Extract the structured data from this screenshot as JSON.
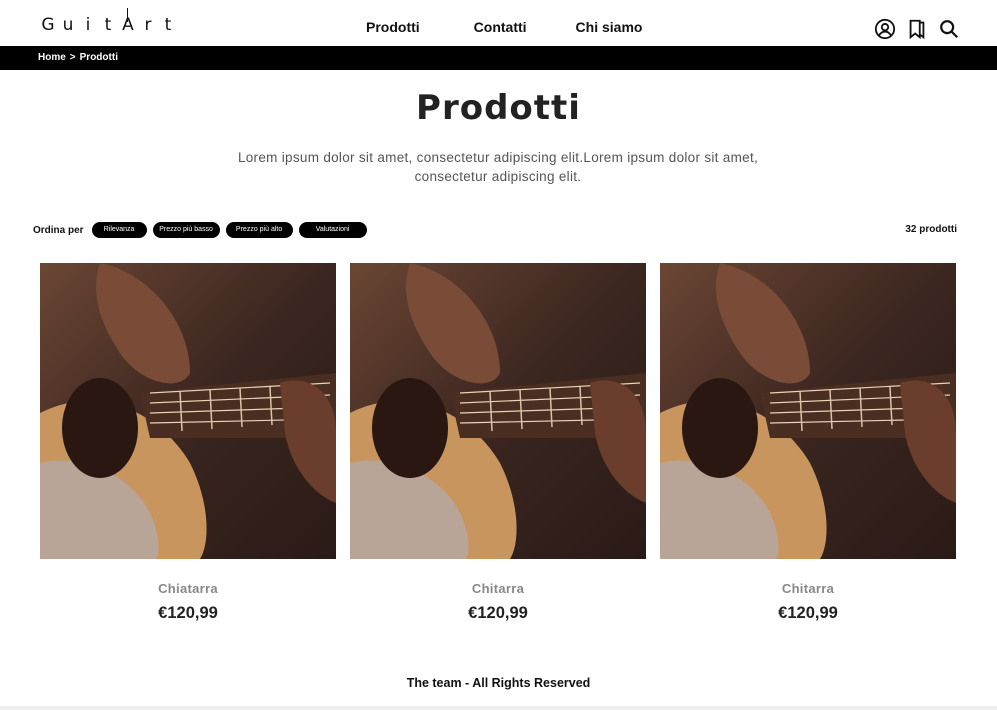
{
  "brand": {
    "logo_text": [
      "G",
      "u",
      "i",
      "t",
      "A",
      "r",
      "t"
    ]
  },
  "nav": {
    "items": [
      "Prodotti",
      "Contatti",
      "Chi siamo"
    ]
  },
  "header_icons": [
    "user-icon",
    "bookmark-icon",
    "search-icon"
  ],
  "breadcrumb": {
    "home": "Home",
    "separator": ">",
    "current": "Prodotti"
  },
  "page": {
    "title": "Prodotti",
    "intro": "Lorem ipsum dolor sit amet, consectetur adipiscing elit.Lorem ipsum dolor sit amet, consectetur adipiscing elit."
  },
  "sort": {
    "label": "Ordina per",
    "options": [
      "Rilevanza",
      "Prezzo più basso",
      "Prezzo più alto",
      "Valutazioni"
    ],
    "count": "32 prodotti"
  },
  "products": [
    {
      "name": "Chiatarra",
      "price": "€120,99"
    },
    {
      "name": "Chitarra",
      "price": "€120,99"
    },
    {
      "name": "Chitarra",
      "price": "€120,99"
    }
  ],
  "footer": {
    "text": "The team - All Rights Reserved"
  },
  "colors": {
    "bar": "#000000",
    "muted_text": "#888888",
    "guitar_body": "#c9955f",
    "background_wood": "#3a2620"
  }
}
